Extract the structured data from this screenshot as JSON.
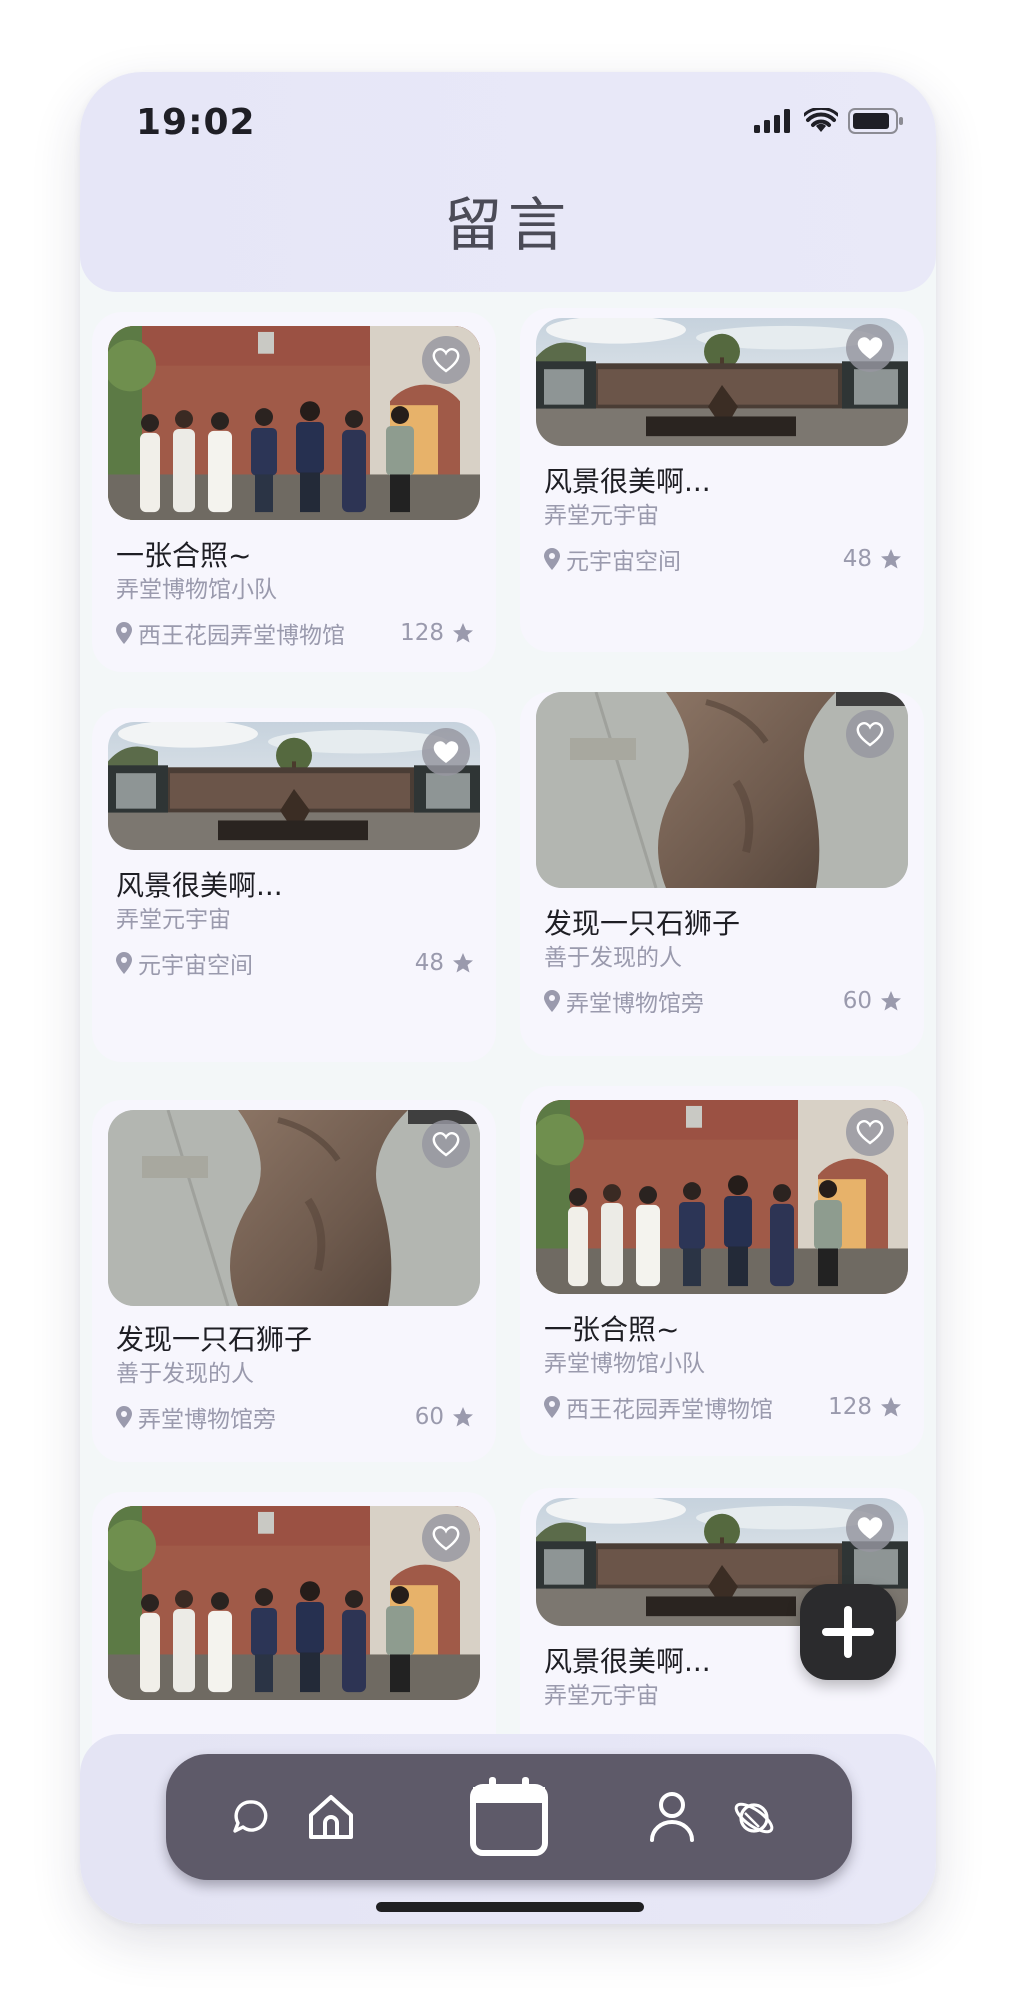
{
  "status_bar": {
    "time": "19:02"
  },
  "header": {
    "title": "留言"
  },
  "cards": [
    {
      "title": "一张合照~",
      "author": "弄堂博物馆小队",
      "location": "西王花园弄堂博物馆",
      "likes": "128",
      "photo": "group-photo",
      "favorited": false
    },
    {
      "title": "风景很美啊...",
      "author": "弄堂元宇宙",
      "location": "元宇宙空间",
      "likes": "48",
      "photo": "courtyard-photo",
      "favorited": true
    },
    {
      "title": "风景很美啊...",
      "author": "弄堂元宇宙",
      "location": "元宇宙空间",
      "likes": "48",
      "photo": "courtyard-photo",
      "favorited": true
    },
    {
      "title": "发现一只石狮子",
      "author": "善于发现的人",
      "location": "弄堂博物馆旁",
      "likes": "60",
      "photo": "stone-lion-photo",
      "favorited": false
    },
    {
      "title": "发现一只石狮子",
      "author": "善于发现的人",
      "location": "弄堂博物馆旁",
      "likes": "60",
      "photo": "stone-lion-photo",
      "favorited": false
    },
    {
      "title": "一张合照~",
      "author": "弄堂博物馆小队",
      "location": "西王花园弄堂博物馆",
      "likes": "128",
      "photo": "group-photo",
      "favorited": false
    },
    {
      "title": "",
      "author": "",
      "location": "",
      "likes": "",
      "photo": "group-photo",
      "favorited": false
    },
    {
      "title": "风景很美啊...",
      "author": "弄堂元宇宙",
      "location": "",
      "likes": "",
      "photo": "courtyard-photo",
      "favorited": true
    }
  ],
  "fab": {
    "icon": "plus-icon"
  },
  "tab_bar": {
    "items": [
      {
        "icon": "chat-bubble-icon",
        "active": false
      },
      {
        "icon": "home-icon",
        "active": false
      },
      {
        "icon": "calendar-icon",
        "active": true
      },
      {
        "icon": "person-icon",
        "active": false
      },
      {
        "icon": "planet-icon",
        "active": false
      }
    ]
  },
  "colors": {
    "header_bg": "#e6e6f7",
    "feed_bg": "#f3f7f8",
    "card_bg": "#f7f6fd",
    "secondary_text": "#9a9aad",
    "tab_bar_bg": "#5e5a69",
    "fab_bg": "#2b2b2d"
  }
}
